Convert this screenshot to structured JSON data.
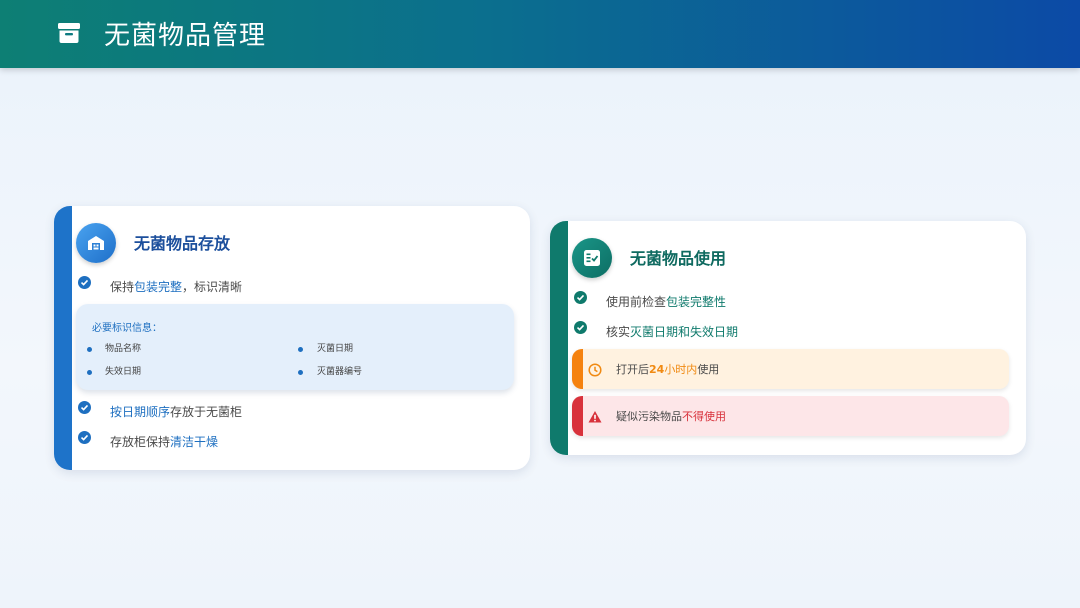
{
  "header": {
    "title": "无菌物品管理",
    "icon": "archive-box-icon"
  },
  "storage_card": {
    "title": "无菌物品存放",
    "icon": "warehouse-icon",
    "items": [
      {
        "prefix": "保持",
        "highlight": "包装完整",
        "suffix": "，标识清晰"
      },
      {
        "prefix": "",
        "highlight": "按日期顺序",
        "suffix": "存放于无菌柜"
      },
      {
        "prefix": "存放柜保持",
        "highlight": "清洁干燥",
        "suffix": ""
      }
    ],
    "info_box": {
      "title": "必要标识信息：",
      "items": [
        "物品名称",
        "灭菌日期",
        "失效日期",
        "灭菌器编号"
      ]
    }
  },
  "usage_card": {
    "title": "无菌物品使用",
    "icon": "checklist-icon",
    "items": [
      {
        "prefix": "使用前检查",
        "highlight": "包装完整性",
        "suffix": ""
      },
      {
        "prefix": "核实",
        "highlight": "灭菌日期和失效日期",
        "suffix": ""
      }
    ],
    "alerts": [
      {
        "type": "warning",
        "icon": "clock-icon",
        "prefix": "打开后",
        "strong_num": "24",
        "strong_text": "小时内",
        "suffix": "使用"
      },
      {
        "type": "danger",
        "icon": "warning-triangle-icon",
        "prefix": "疑似污染物品",
        "strong": "不得使用"
      }
    ]
  },
  "colors": {
    "header_start": "#0d7f74",
    "header_end": "#0c4aa6",
    "blue_accent": "#1e73c9",
    "green_accent": "#0f7a6c",
    "warning": "#f5820f",
    "danger": "#d8323c"
  }
}
